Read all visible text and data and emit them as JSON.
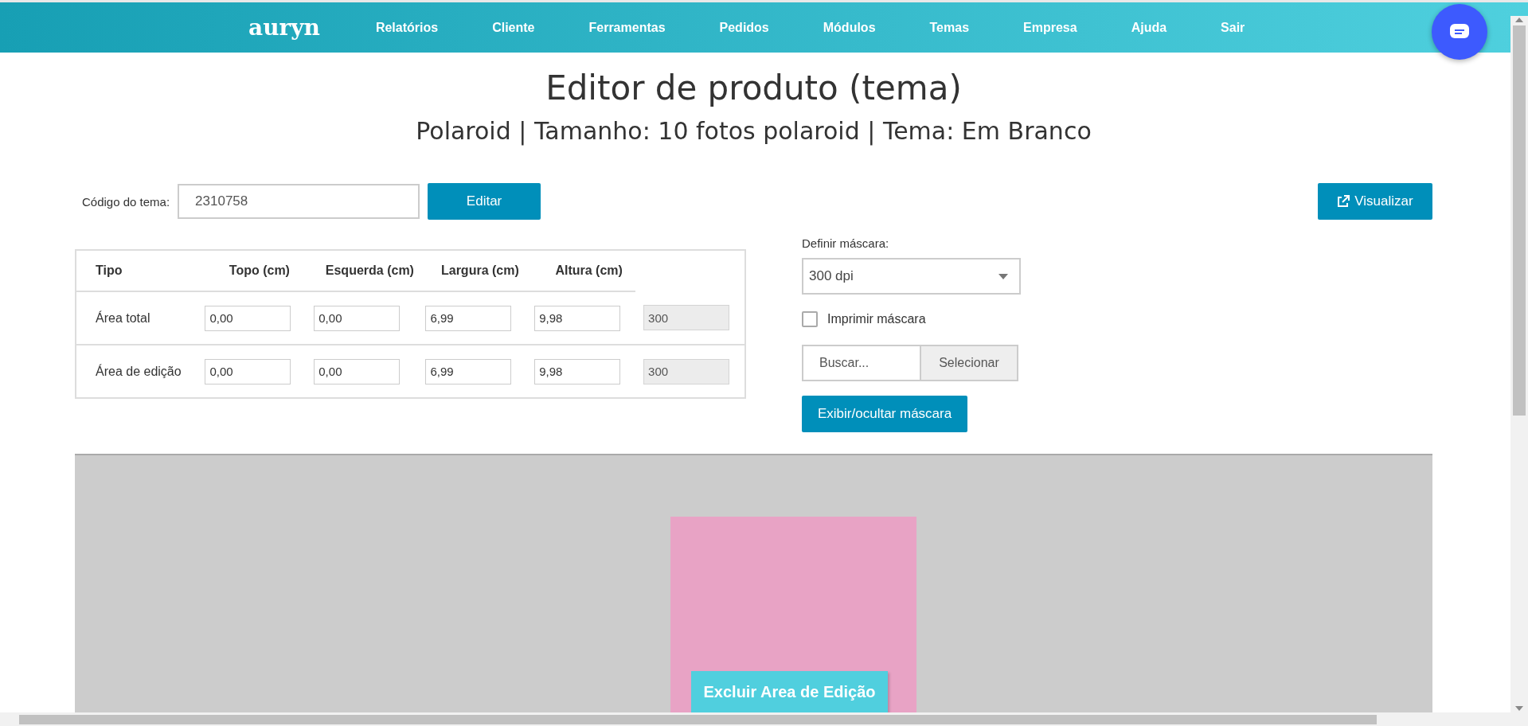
{
  "nav": {
    "logo": "auryn",
    "items": [
      "Relatórios",
      "Cliente",
      "Ferramentas",
      "Pedidos",
      "Módulos",
      "Temas",
      "Empresa",
      "Ajuda",
      "Sair"
    ]
  },
  "page": {
    "title": "Editor de produto (tema)",
    "subtitle": "Polaroid | Tamanho: 10 fotos polaroid | Tema: Em Branco"
  },
  "theme_code": {
    "label": "Código do tema:",
    "value": "2310758",
    "button": "Editar"
  },
  "preview_button": "Visualizar",
  "table": {
    "columns": [
      "Tipo",
      "Topo (cm)",
      "Esquerda (cm)",
      "Largura (cm)",
      "Altura (cm)"
    ],
    "rows": [
      {
        "label": "Área total",
        "fields": [
          {
            "value": "0,00",
            "disabled": false
          },
          {
            "value": "0,00",
            "disabled": false
          },
          {
            "value": "6,99",
            "disabled": false
          },
          {
            "value": "9,98",
            "disabled": false
          },
          {
            "value": "300",
            "disabled": true
          }
        ]
      },
      {
        "label": "Área de edição",
        "fields": [
          {
            "value": "0,00",
            "disabled": false
          },
          {
            "value": "0,00",
            "disabled": false
          },
          {
            "value": "6,99",
            "disabled": false
          },
          {
            "value": "9,98",
            "disabled": false
          },
          {
            "value": "300",
            "disabled": true
          }
        ]
      }
    ]
  },
  "mask": {
    "label": "Definir máscara:",
    "select_value": "300 dpi",
    "print_label": "Imprimir máscara",
    "print_checked": false,
    "file_placeholder": "Buscar...",
    "file_button": "Selecionar",
    "toggle_button": "Exibir/ocultar máscara"
  },
  "canvas": {
    "delete_button": "Excluir Area de Edição"
  }
}
